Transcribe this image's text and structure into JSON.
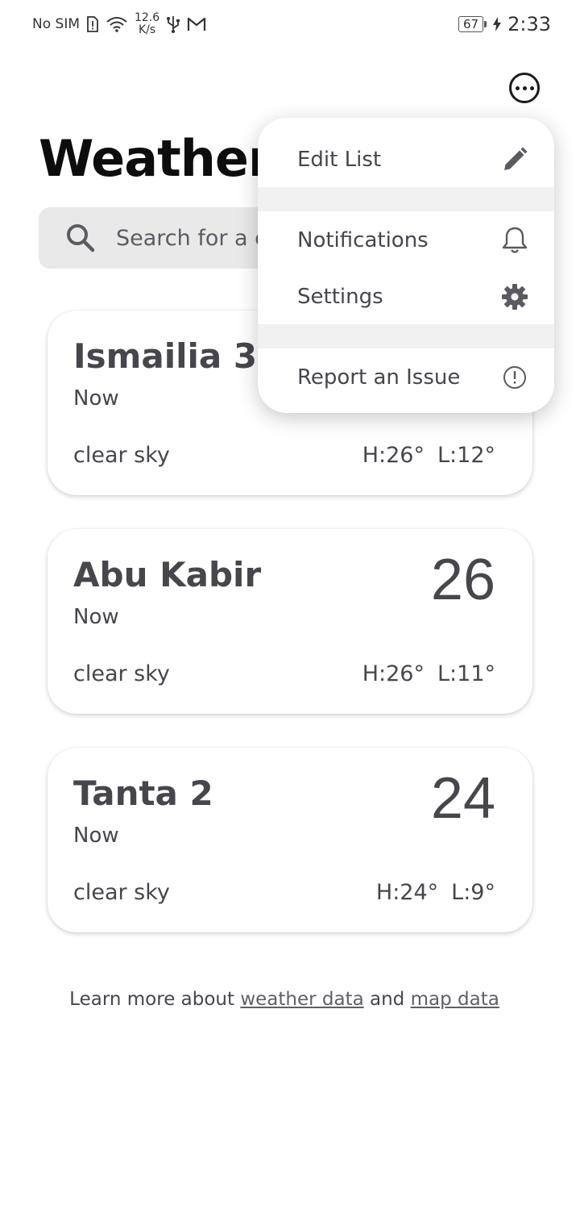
{
  "status_bar": {
    "carrier": "No SIM",
    "speed_value": "12.6",
    "speed_unit": "K/s",
    "battery": "67",
    "time": "2:33"
  },
  "header": {
    "title": "Weather",
    "more_icon": "more-horizontal-circle-icon"
  },
  "search": {
    "placeholder": "Search for a city",
    "visible_text": "Search for a ci",
    "icon": "search-icon"
  },
  "cities": [
    {
      "name": "Ismailia 3",
      "time": "Now",
      "temp": "",
      "condition": "clear sky",
      "high": "H:26°",
      "low": "L:12°"
    },
    {
      "name": "Abu Kabir",
      "time": "Now",
      "temp": "26",
      "condition": "clear sky",
      "high": "H:26°",
      "low": "L:11°"
    },
    {
      "name": "Tanta 2",
      "time": "Now",
      "temp": "24",
      "condition": "clear sky",
      "high": "H:24°",
      "low": "L:9°"
    }
  ],
  "footer": {
    "prefix": "Learn more about ",
    "link1": "weather data",
    "middle": " and ",
    "link2": "map data"
  },
  "menu": {
    "items": [
      {
        "label": "Edit List",
        "icon": "pencil-icon"
      },
      {
        "label": "Notifications",
        "icon": "bell-icon"
      },
      {
        "label": "Settings",
        "icon": "gear-icon"
      },
      {
        "label": "Report an Issue",
        "icon": "alert-circle-icon"
      }
    ]
  }
}
